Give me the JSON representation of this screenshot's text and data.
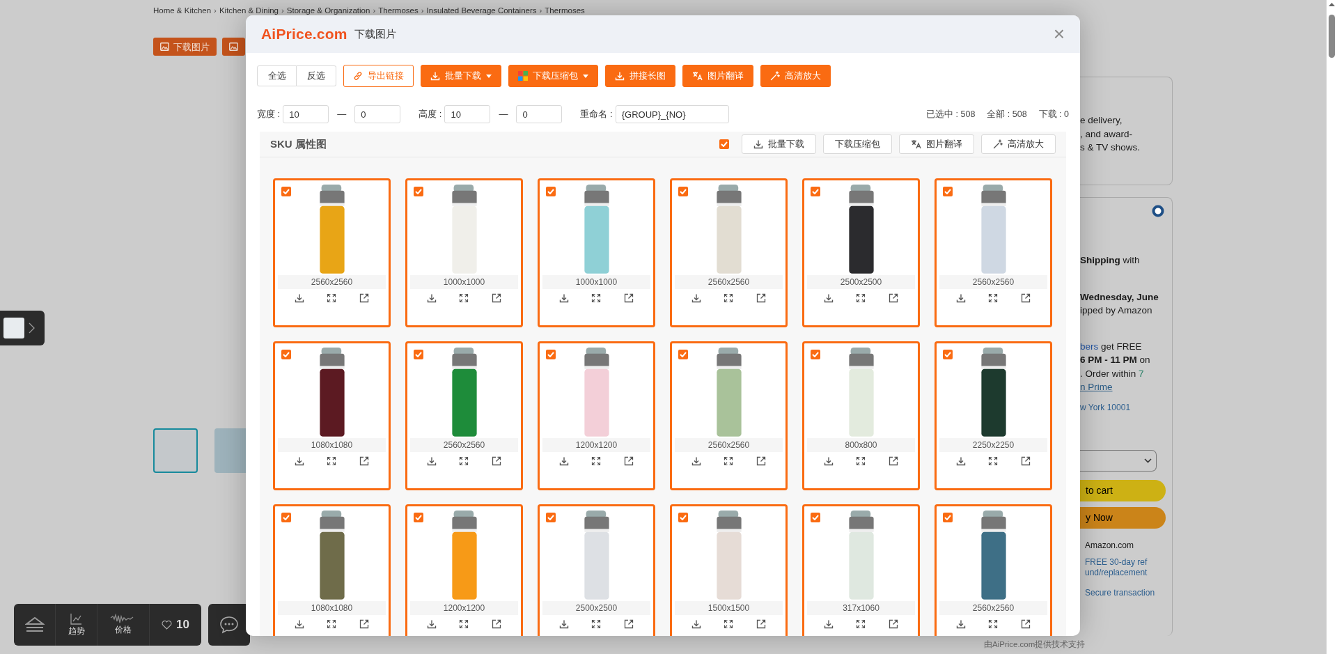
{
  "page": {
    "breadcrumb": [
      "Home & Kitchen",
      "Kitchen & Dining",
      "Storage & Organization",
      "Thermoses",
      "Insulated Beverage Containers",
      "Thermoses"
    ],
    "breadcrumb_separator": "›",
    "download_button": "下载图片",
    "thumbnails": [
      {
        "selected": true
      },
      {
        "selected": false
      }
    ],
    "bottom_toolbar": {
      "trend": "趋势",
      "price": "价格",
      "likes": "10"
    },
    "right_panel": {
      "card_lines": [
        "e delivery,",
        ", and award-",
        "s & TV shows."
      ],
      "lines": [
        [
          {
            "text": "**Shipping** with",
            "kind": "text"
          }
        ],
        [
          {
            "text": "**Wednesday, June**",
            "kind": "text"
          }
        ],
        [
          {
            "text": "ipped by Amazon",
            "kind": "text"
          }
        ],
        [
          {
            "text": "bers",
            "kind": "link"
          },
          {
            "text": " get FREE",
            "kind": "text"
          }
        ],
        [
          {
            "text": "**6 PM - 11 PM** on",
            "kind": "text"
          }
        ],
        [
          {
            "text": ". Order within ",
            "kind": "text"
          },
          {
            "text": "7",
            "kind": "timer"
          }
        ],
        [
          {
            "text": "n Prime",
            "kind": "link"
          }
        ]
      ],
      "location": "w York 10001",
      "add_to_cart": "to cart",
      "buy_now": "y Now",
      "sold_by": "Amazon.com",
      "returns": "FREE 30-day refund/replacement",
      "secure": "Secure transaction"
    },
    "footer_credit": "由AiPrice.com提供技术支持"
  },
  "dialog": {
    "logo": "AiPrice.com",
    "title": "下载图片",
    "close": "×",
    "selection_buttons": [
      "全选",
      "反选"
    ],
    "actions": [
      {
        "label": "导出链接",
        "kind": "outline"
      },
      {
        "label": "批量下载",
        "kind": "dropdown"
      },
      {
        "label": "下载压缩包",
        "kind": "dropdown"
      },
      {
        "label": "拼接长图",
        "kind": "solid"
      },
      {
        "label": "图片翻译",
        "kind": "solid"
      },
      {
        "label": "高清放大",
        "kind": "solid"
      }
    ],
    "filters": {
      "width_label": "宽度 :",
      "width_min": "10",
      "width_separator": "—",
      "width_max": "0",
      "height_label": "高度 :",
      "height_min": "10",
      "height_separator": "—",
      "height_max": "0",
      "rename_label": "重命名 :",
      "rename_value": "{GROUP}_{NO}"
    },
    "stats": [
      "已选中 : 508",
      "全部 : 508",
      "下载 : 0"
    ],
    "section": {
      "title": "SKU 属性图",
      "checked": true,
      "actions": [
        "批量下载",
        "下载压缩包",
        "图片翻译",
        "高清放大"
      ]
    },
    "images": [
      {
        "size": "2560x2560",
        "checked": true,
        "color": "#e8a516"
      },
      {
        "size": "1000x1000",
        "checked": true,
        "color": "#f0efea"
      },
      {
        "size": "1000x1000",
        "checked": true,
        "color": "#8fd0d6"
      },
      {
        "size": "2560x2560",
        "checked": true,
        "color": "#e2ddd2"
      },
      {
        "size": "2500x2500",
        "checked": true,
        "color": "#2b2b2e"
      },
      {
        "size": "2560x2560",
        "checked": true,
        "color": "#cfd8e3"
      },
      {
        "size": "1080x1080",
        "checked": true,
        "color": "#5c1a22"
      },
      {
        "size": "2560x2560",
        "checked": true,
        "color": "#1e8c3a"
      },
      {
        "size": "1200x1200",
        "checked": true,
        "color": "#f3cfd8"
      },
      {
        "size": "2560x2560",
        "checked": true,
        "color": "#a9c29a"
      },
      {
        "size": "800x800",
        "checked": true,
        "color": "#e3ebde"
      },
      {
        "size": "2250x2250",
        "checked": true,
        "color": "#1d3a2e"
      },
      {
        "size": "1080x1080",
        "checked": true,
        "color": "#6f6c4a"
      },
      {
        "size": "1200x1200",
        "checked": true,
        "color": "#f79a17"
      },
      {
        "size": "2500x2500",
        "checked": true,
        "color": "#dde0e4"
      },
      {
        "size": "1500x1500",
        "checked": true,
        "color": "#e6dcd6"
      },
      {
        "size": "317x1060",
        "checked": true,
        "color": "#dfe8e0"
      },
      {
        "size": "2560x2560",
        "checked": true,
        "color": "#3e6f86"
      }
    ]
  }
}
